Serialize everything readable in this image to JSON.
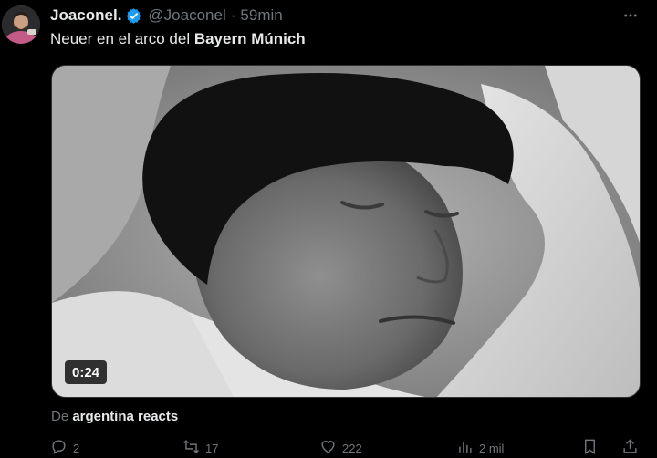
{
  "tweet": {
    "display_name": "Joaconel.",
    "handle": "@Joaconel",
    "separator": "·",
    "time": "59min",
    "text_prefix": "Neuer en el arco del ",
    "text_bold": "Bayern Múnich",
    "media": {
      "duration": "0:24"
    },
    "source_prefix": "De ",
    "source_name": "argentina reacts",
    "actions": {
      "reply_count": "2",
      "retweet_count": "17",
      "like_count": "222",
      "views_count": "2 mil"
    }
  },
  "icons": {
    "verified": "verified-badge-icon",
    "more": "more-horizontal-icon",
    "reply": "reply-icon",
    "retweet": "retweet-icon",
    "like": "heart-icon",
    "views": "views-icon",
    "bookmark": "bookmark-icon",
    "share": "share-icon"
  },
  "colors": {
    "background": "#000000",
    "primary_text": "#e7e9ea",
    "secondary_text": "#71767b",
    "verified_blue": "#1d9bf0"
  }
}
